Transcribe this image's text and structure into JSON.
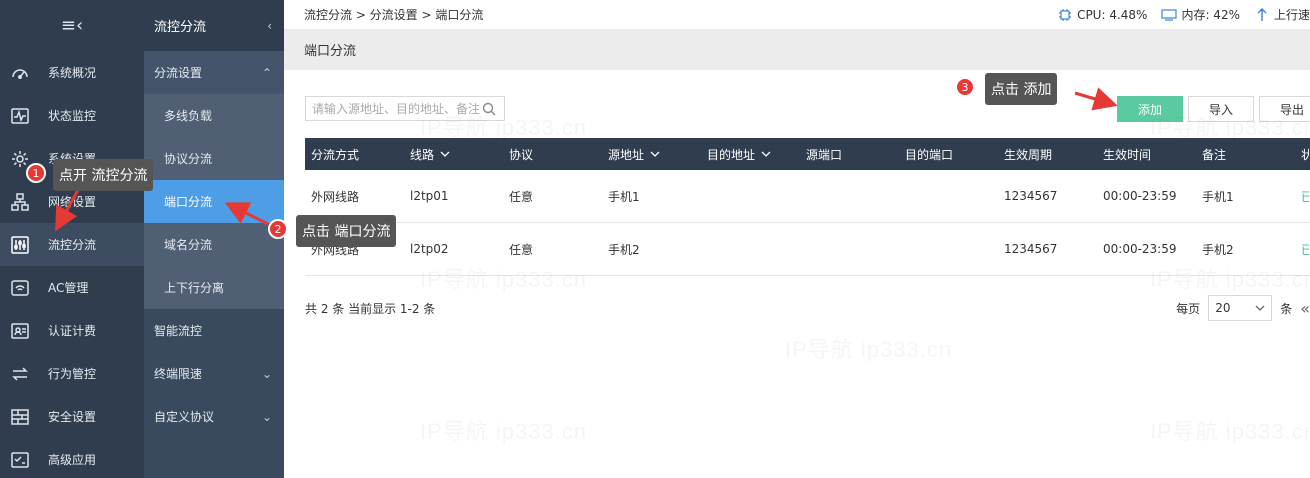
{
  "sidebar": {
    "collapse_icon": "≡‹",
    "items": [
      {
        "label": "系统概况",
        "icon": "gauge-icon"
      },
      {
        "label": "状态监控",
        "icon": "pulse-icon"
      },
      {
        "label": "系统设置",
        "icon": "gear-icon"
      },
      {
        "label": "网络设置",
        "icon": "network-icon"
      },
      {
        "label": "流控分流",
        "icon": "sliders-icon",
        "active": true
      },
      {
        "label": "AC管理",
        "icon": "wifi-icon"
      },
      {
        "label": "认证计费",
        "icon": "id-card-icon"
      },
      {
        "label": "行为管控",
        "icon": "swap-icon"
      },
      {
        "label": "安全设置",
        "icon": "firewall-icon"
      },
      {
        "label": "高级应用",
        "icon": "checklist-icon"
      }
    ]
  },
  "submenu": {
    "title": "流控分流",
    "group": "分流设置",
    "subitems": [
      "多线负载",
      "协议分流",
      "端口分流",
      "域名分流",
      "上下行分离"
    ],
    "items": [
      "智能流控",
      "终端限速",
      "自定义协议"
    ]
  },
  "topbar": {
    "breadcrumb": "流控分流 > 分流设置 > 端口分流",
    "cpu": "CPU: 4.48%",
    "memory": "内存: 42%",
    "upload": "上行速"
  },
  "page": {
    "title": "端口分流"
  },
  "toolbar": {
    "search_placeholder": "请输入源地址、目的地址、备注",
    "add": "添加",
    "import": "导入",
    "export": "导出"
  },
  "table": {
    "headers": [
      "分流方式",
      "线路",
      "协议",
      "源地址",
      "目的地址",
      "源端口",
      "目的端口",
      "生效周期",
      "生效时间",
      "备注",
      "状"
    ],
    "rows": [
      [
        "外网线路",
        "l2tp01",
        "任意",
        "手机1",
        "",
        "",
        "",
        "1234567",
        "00:00-23:59",
        "手机1",
        "已"
      ],
      [
        "外网线路",
        "l2tp02",
        "任意",
        "手机2",
        "",
        "",
        "",
        "1234567",
        "00:00-23:59",
        "手机2",
        "已"
      ]
    ]
  },
  "footer": {
    "summary": "共 2 条 当前显示 1-2 条",
    "per_page_label": "每页",
    "per_page_value": "20",
    "unit": "条"
  },
  "annotations": {
    "step1": {
      "num": "1",
      "text": "点开 流控分流"
    },
    "step2": {
      "num": "2",
      "text": "点击 端口分流"
    },
    "step3": {
      "num": "3",
      "text": "点击 添加"
    }
  },
  "watermark": "IP导航  ip333.cn",
  "colors": {
    "sidebar": "#2f3d4f",
    "submenu": "#3a4a5e",
    "active_sub": "#4d9ee6",
    "add_button": "#5ccaa0",
    "annotation_red": "#e53935"
  }
}
